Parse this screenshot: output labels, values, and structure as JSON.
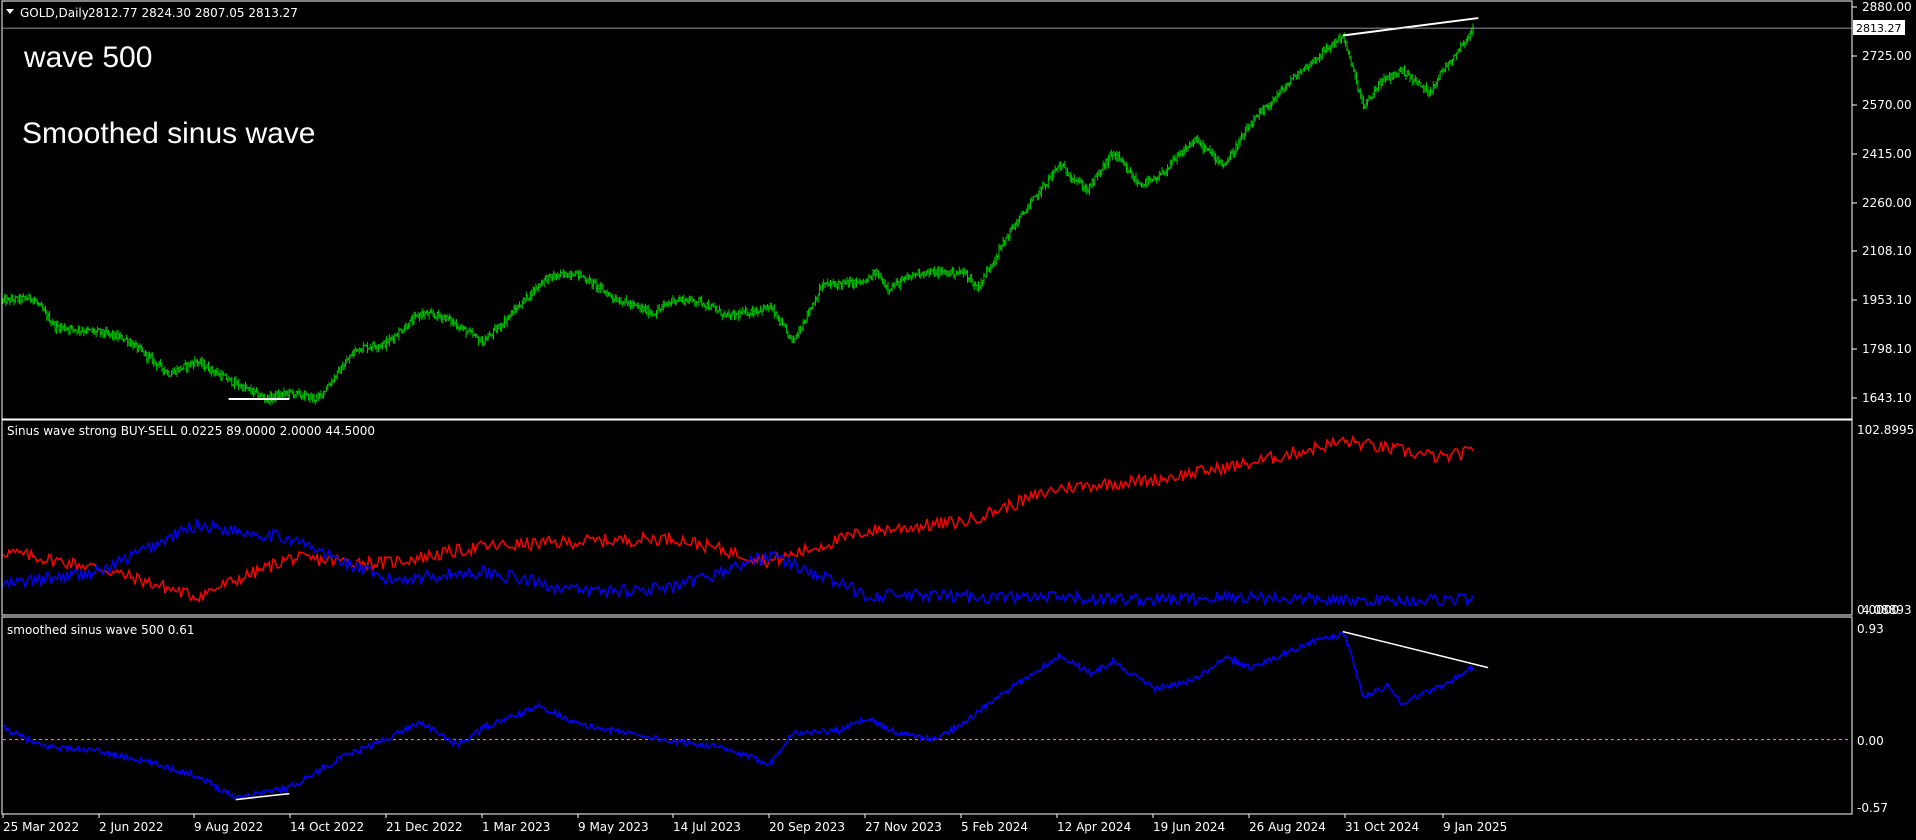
{
  "colors": {
    "background": "#000000",
    "frame": "#ffffff",
    "price_bars": "#00c800",
    "sell_line": "#ff0000",
    "buy_line": "#0000ff",
    "smoothed_line": "#0000ff",
    "divergence_lines": "#ffffff",
    "zero_line": "#ffa500",
    "current_price_line": "#b4c8dc"
  },
  "main": {
    "symbol_label": "GOLD,Daily",
    "ohlc_label": "2812.77 2824.30 2807.05 2813.27",
    "overlay_line1": "wave 500",
    "overlay_line2": "Smoothed sinus wave",
    "current_price": "2813.27",
    "price_axis_labels": [
      "2880.00",
      "2725.00",
      "2570.00",
      "2415.00",
      "2260.00",
      "2108.10",
      "1953.10",
      "1798.10",
      "1643.10"
    ]
  },
  "panel1": {
    "title": "Sinus wave strong BUY-SELL 0.0225 89.0000 2.0000 44.5000",
    "axis_labels": [
      "102.8995",
      "4.08893"
    ],
    "axis_label_overlap": "0.0000"
  },
  "panel2": {
    "title": "smoothed sinus wave 500 0.61",
    "axis_labels": [
      "0.93",
      "0.00",
      "-0.57"
    ]
  },
  "x_axis_labels": [
    "25 Mar 2022",
    "2 Jun 2022",
    "9 Aug 2022",
    "14 Oct 2022",
    "21 Dec 2022",
    "1 Mar 2023",
    "9 May 2023",
    "14 Jul 2023",
    "20 Sep 2023",
    "27 Nov 2023",
    "5 Feb 2024",
    "12 Apr 2024",
    "19 Jun 2024",
    "26 Aug 2024",
    "31 Oct 2024",
    "9 Jan 2025"
  ],
  "chart_data": [
    {
      "type": "bar",
      "subtype": "ohlc",
      "symbol": "GOLD",
      "timeframe": "Daily",
      "ylim": [
        1600,
        2880
      ],
      "x": [
        "2022-03-25",
        "2022-04-15",
        "2022-05-01",
        "2022-06-02",
        "2022-06-20",
        "2022-07-21",
        "2022-08-09",
        "2022-09-01",
        "2022-09-28",
        "2022-10-14",
        "2022-11-03",
        "2022-12-01",
        "2022-12-21",
        "2023-01-15",
        "2023-02-01",
        "2023-02-28",
        "2023-03-10",
        "2023-04-13",
        "2023-05-04",
        "2023-05-09",
        "2023-06-01",
        "2023-06-29",
        "2023-07-14",
        "2023-08-01",
        "2023-08-21",
        "2023-09-20",
        "2023-10-06",
        "2023-10-27",
        "2023-11-27",
        "2023-12-04",
        "2023-12-13",
        "2024-01-03",
        "2024-02-05",
        "2024-02-14",
        "2024-03-08",
        "2024-04-12",
        "2024-05-02",
        "2024-05-20",
        "2024-06-07",
        "2024-06-19",
        "2024-07-17",
        "2024-08-07",
        "2024-08-26",
        "2024-09-26",
        "2024-10-30",
        "2024-11-14",
        "2024-11-25",
        "2024-12-11",
        "2024-12-30",
        "2025-01-09",
        "2025-01-24",
        "2025-01-31"
      ],
      "values": [
        1950,
        1960,
        1870,
        1850,
        1830,
        1720,
        1760,
        1700,
        1640,
        1660,
        1640,
        1800,
        1815,
        1910,
        1900,
        1820,
        1860,
        2020,
        2040,
        2030,
        1960,
        1910,
        1955,
        1950,
        1900,
        1930,
        1820,
        2000,
        2010,
        2040,
        1990,
        2040,
        2040,
        1990,
        2170,
        2380,
        2300,
        2420,
        2320,
        2330,
        2460,
        2380,
        2510,
        2660,
        2790,
        2560,
        2640,
        2680,
        2610,
        2680,
        2770,
        2813
      ],
      "last_bar": {
        "open": 2812.77,
        "high": 2824.3,
        "low": 2807.05,
        "close": 2813.27
      }
    },
    {
      "type": "line",
      "title": "Sinus wave strong BUY-SELL 0.0225 89.0000 2.0000 44.5000",
      "ylim": [
        0,
        102.8995
      ],
      "x": [
        "2022-03-25",
        "2022-06-02",
        "2022-08-09",
        "2022-10-14",
        "2022-12-21",
        "2023-03-01",
        "2023-05-09",
        "2023-07-14",
        "2023-09-20",
        "2023-11-27",
        "2024-02-05",
        "2024-04-12",
        "2024-06-19",
        "2024-08-26",
        "2024-10-31",
        "2025-01-09",
        "2025-01-31"
      ],
      "series": [
        {
          "values": [
            32,
            22,
            5,
            28,
            25,
            35,
            38,
            40,
            26,
            44,
            50,
            70,
            75,
            85,
            98,
            88,
            92
          ]
        },
        {
          "values": [
            12,
            20,
            48,
            40,
            15,
            20,
            8,
            10,
            30,
            6,
            5,
            4,
            3,
            5,
            2,
            3,
            4
          ]
        }
      ]
    },
    {
      "type": "line",
      "title": "smoothed sinus wave 500 0.61",
      "ylim": [
        -0.57,
        0.93
      ],
      "x": [
        "2022-03-25",
        "2022-04-20",
        "2022-06-02",
        "2022-07-10",
        "2022-08-09",
        "2022-09-06",
        "2022-10-14",
        "2022-11-20",
        "2022-12-21",
        "2023-01-15",
        "2023-02-10",
        "2023-03-01",
        "2023-04-10",
        "2023-05-09",
        "2023-06-15",
        "2023-07-14",
        "2023-08-10",
        "2023-09-20",
        "2023-10-05",
        "2023-11-10",
        "2023-11-27",
        "2023-12-20",
        "2024-01-15",
        "2024-02-05",
        "2024-02-28",
        "2024-04-12",
        "2024-05-05",
        "2024-05-20",
        "2024-06-19",
        "2024-07-17",
        "2024-08-08",
        "2024-08-26",
        "2024-09-20",
        "2024-10-04",
        "2024-10-31",
        "2024-11-14",
        "2024-12-01",
        "2024-12-11",
        "2024-12-25",
        "2025-01-09",
        "2025-01-31"
      ],
      "values": [
        0.1,
        -0.05,
        -0.1,
        -0.2,
        -0.3,
        -0.48,
        -0.4,
        -0.15,
        0.0,
        0.15,
        -0.05,
        0.1,
        0.28,
        0.12,
        0.05,
        -0.02,
        -0.05,
        -0.2,
        0.05,
        0.08,
        0.18,
        0.05,
        0.0,
        0.15,
        0.35,
        0.7,
        0.55,
        0.65,
        0.42,
        0.5,
        0.68,
        0.6,
        0.72,
        0.8,
        0.88,
        0.35,
        0.45,
        0.3,
        0.38,
        0.45,
        0.61
      ]
    }
  ]
}
